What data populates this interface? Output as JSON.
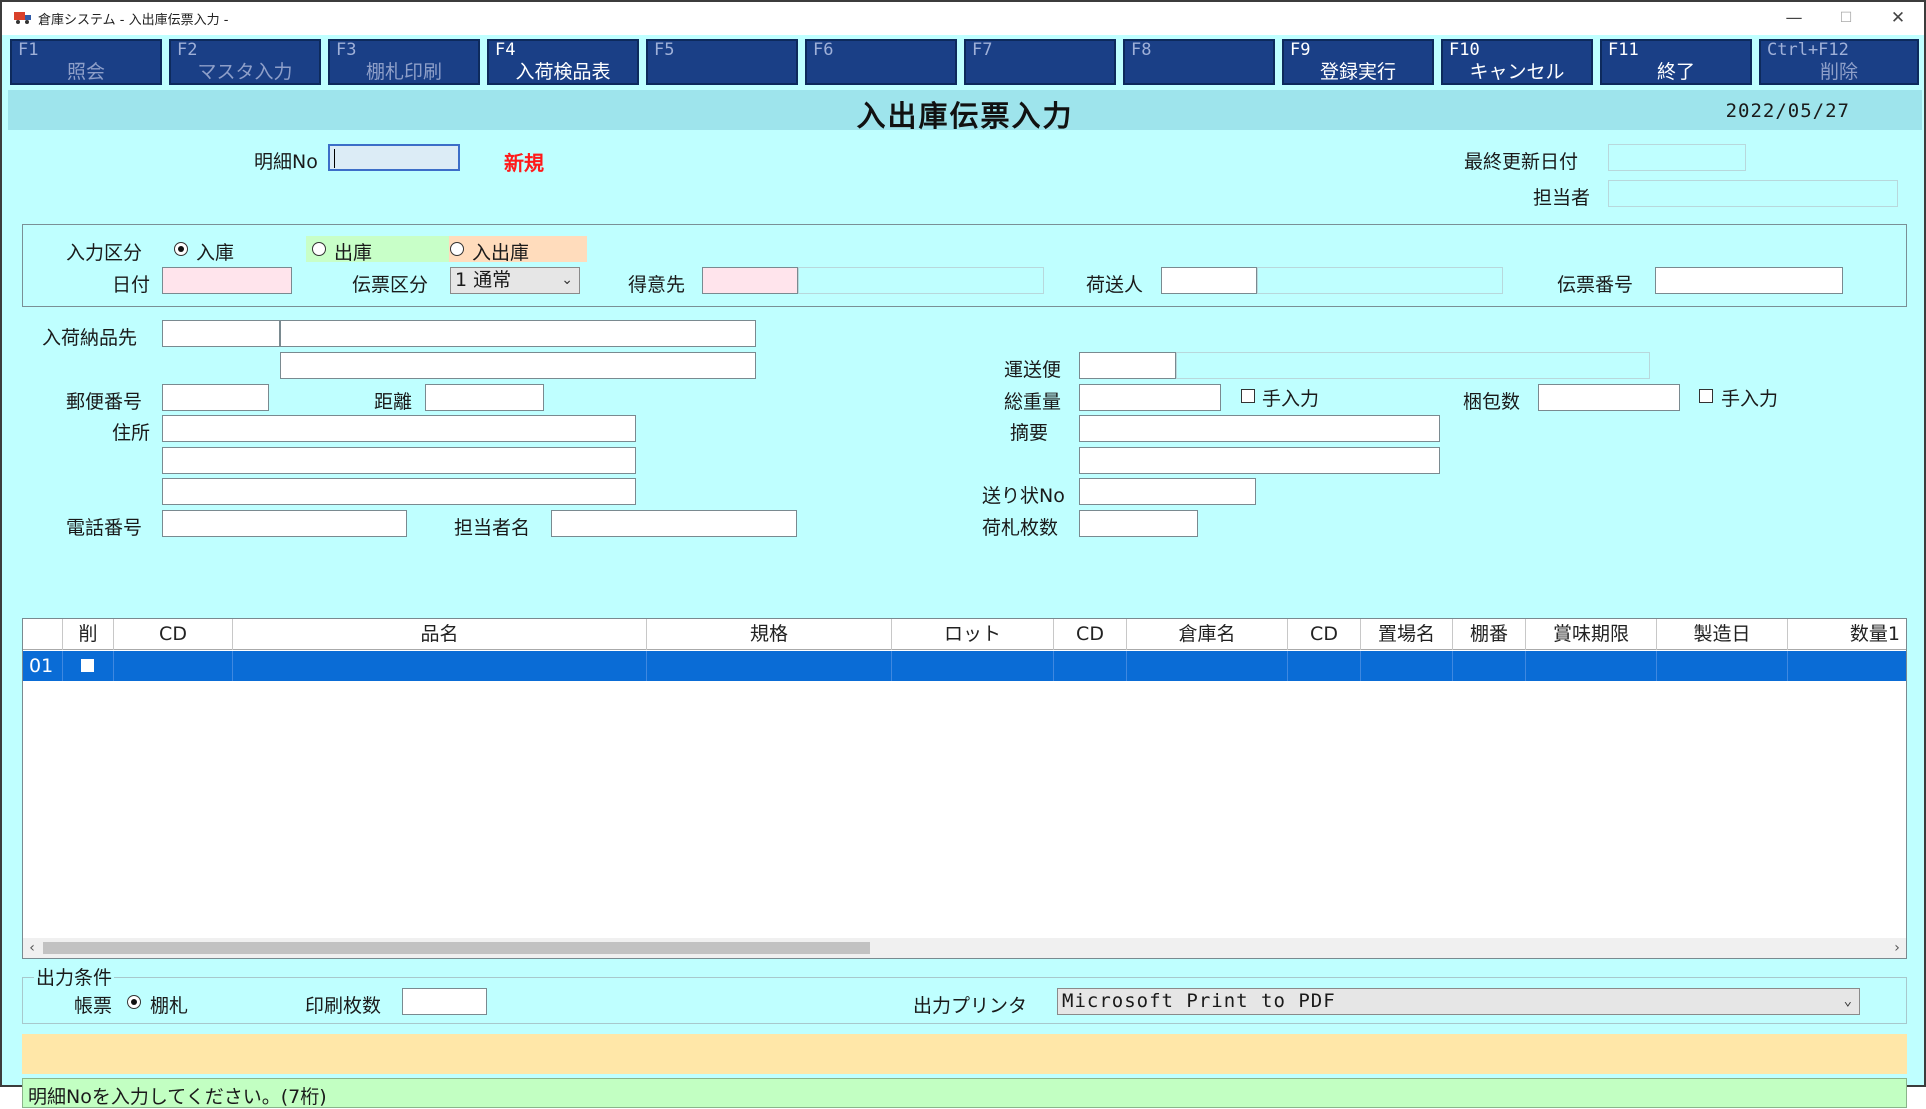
{
  "window": {
    "title": "倉庫システム - 入出庫伝票入力 -",
    "controls": {
      "minimize": "—",
      "maximize": "☐",
      "close": "✕"
    }
  },
  "fkeys": [
    {
      "code": "F1",
      "label": "照会",
      "active": false
    },
    {
      "code": "F2",
      "label": "マスタ入力",
      "active": false
    },
    {
      "code": "F3",
      "label": "棚札印刷",
      "active": false
    },
    {
      "code": "F4",
      "label": "入荷検品表",
      "active": true
    },
    {
      "code": "F5",
      "label": "",
      "active": false
    },
    {
      "code": "F6",
      "label": "",
      "active": false
    },
    {
      "code": "F7",
      "label": "",
      "active": false
    },
    {
      "code": "F8",
      "label": "",
      "active": false
    },
    {
      "code": "F9",
      "label": "登録実行",
      "active": true
    },
    {
      "code": "F10",
      "label": "キャンセル",
      "active": true
    },
    {
      "code": "F11",
      "label": "終了",
      "active": true
    },
    {
      "code": "Ctrl+F12",
      "label": "削除",
      "active": false
    }
  ],
  "header": {
    "title": "入出庫伝票入力",
    "date": "2022/05/27"
  },
  "detail": {
    "detail_no_label": "明細No",
    "detail_no_value": "",
    "status": "新規",
    "last_updated_label": "最終更新日付",
    "last_updated_value": "",
    "person_label": "担当者",
    "person_value": ""
  },
  "form": {
    "input_type_label": "入力区分",
    "radio_in": "入庫",
    "radio_out": "出庫",
    "radio_inout": "入出庫",
    "selected_radio": "入庫",
    "date_label": "日付",
    "date_value": "",
    "slip_type_label": "伝票区分",
    "slip_type_value": "1 通常",
    "customer_label": "得意先",
    "customer_code": "",
    "customer_name": "",
    "shipper_label": "荷送人",
    "shipper_code": "",
    "shipper_name": "",
    "slip_no_label": "伝票番号",
    "slip_no_value": ""
  },
  "delivery": {
    "dest_label": "入荷納品先",
    "postal_label": "郵便番号",
    "distance_label": "距離",
    "address_label": "住所",
    "phone_label": "電話番号",
    "contact_label": "担当者名",
    "carrier_label": "運送便",
    "weight_label": "総重量",
    "weight_manual": "手入力",
    "packages_label": "梱包数",
    "packages_manual": "手入力",
    "summary_label": "摘要",
    "invoice_label": "送り状No",
    "tags_label": "荷札枚数"
  },
  "grid": {
    "columns": [
      "",
      "削",
      "CD",
      "品名",
      "規格",
      "ロット",
      "CD",
      "倉庫名",
      "CD",
      "置場名",
      "棚番",
      "賞味期限",
      "製造日",
      "数量1"
    ],
    "rows": [
      {
        "no": "01",
        "deleted": false
      }
    ],
    "scroll_left": "‹",
    "scroll_right": "›"
  },
  "output": {
    "group_label": "出力条件",
    "form_label": "帳票",
    "form_option": "棚札",
    "copies_label": "印刷枚数",
    "copies_value": "",
    "printer_label": "出力プリンタ",
    "printer_value": "Microsoft Print to PDF"
  },
  "status_message": "明細Noを入力してください。(7桁)",
  "colors": {
    "background": "#bfffff",
    "fkey": "#1a3f86",
    "header_band": "#9ee4ec",
    "selected_row": "#0a6cd6",
    "required_field": "#ffe4ec",
    "status_bar": "#c2ffc2",
    "message_bar": "#ffe7a8",
    "new_tag": "#ff1a1a"
  }
}
